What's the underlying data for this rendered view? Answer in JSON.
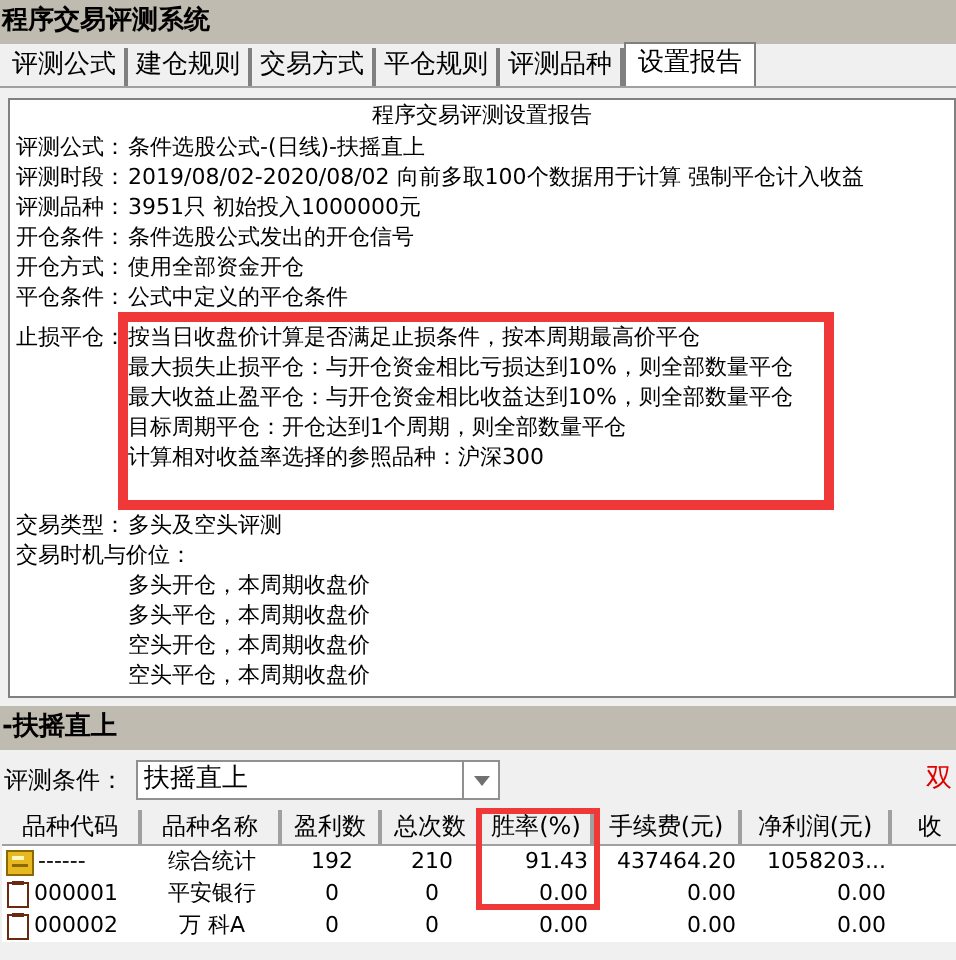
{
  "window": {
    "title": "程序交易评测系统"
  },
  "tabs": [
    {
      "label": "评测公式",
      "selected": false
    },
    {
      "label": "建仓规则",
      "selected": false
    },
    {
      "label": "交易方式",
      "selected": false
    },
    {
      "label": "平仓规则",
      "selected": false
    },
    {
      "label": "评测品种",
      "selected": false
    },
    {
      "label": "设置报告",
      "selected": true
    }
  ],
  "report": {
    "title": "程序交易评测设置报告",
    "blocks": [
      [
        {
          "kind": "inline",
          "label": "评测公式：",
          "lines": [
            "条件选股公式-(日线)-扶摇直上"
          ]
        },
        {
          "kind": "inline",
          "label": "评测时段：",
          "lines": [
            "2019/08/02-2020/08/02 向前多取100个数据用于计算 强制平仓计入收益"
          ]
        },
        {
          "kind": "inline",
          "label": "评测品种：",
          "lines": [
            "3951只 初始投入1000000元"
          ]
        },
        {
          "kind": "inline",
          "label": "开仓条件：",
          "lines": [
            "条件选股公式发出的开仓信号"
          ]
        },
        {
          "kind": "inline",
          "label": "开仓方式：",
          "lines": [
            "使用全部资金开仓"
          ]
        },
        {
          "kind": "inline",
          "label": "平仓条件：",
          "lines": [
            "公式中定义的平仓条件"
          ]
        },
        {
          "kind": "inline",
          "highlighted": true,
          "label": "止损平仓：",
          "lines": [
            "按当日收盘价计算是否满足止损条件，按本周期最高价平仓",
            "最大损失止损平仓：与开仓资金相比亏损达到10%，则全部数量平仓",
            "最大收益止盈平仓：与开仓资金相比收益达到10%，则全部数量平仓",
            "目标周期平仓：开仓达到1个周期，则全部数量平仓",
            "计算相对收益率选择的参照品种：沪深300"
          ]
        }
      ],
      [
        {
          "kind": "inline",
          "label": "交易类型：",
          "lines": [
            "多头及空头评测"
          ]
        },
        {
          "kind": "below",
          "label": "交易时机与价位：",
          "lines": [
            "多头开仓，本周期收盘价",
            "多头平仓，本周期收盘价",
            "空头开仓，本周期收盘价",
            "空头平仓，本周期收盘价"
          ]
        }
      ]
    ]
  },
  "panel": {
    "title": "-扶摇直上",
    "condition_label": "评测条件：",
    "condition_value": "扶摇直上",
    "hint": "双"
  },
  "table": {
    "columns": [
      "品种代码",
      "品种名称",
      "盈利数",
      "总次数",
      "胜率(%)",
      "手续费(元)",
      "净利润(元)",
      "收"
    ],
    "rows": [
      {
        "kind": "summary",
        "cells": [
          "------",
          "综合统计",
          "192",
          "210",
          "91.43",
          "437464.20",
          "1058203..."
        ]
      },
      {
        "kind": "stock",
        "cells": [
          "000001",
          "平安银行",
          "0",
          "0",
          "0.00",
          "0.00",
          "0.00"
        ]
      },
      {
        "kind": "stock",
        "cells": [
          "000002",
          "万 科A",
          "0",
          "0",
          "0.00",
          "0.00",
          "0.00"
        ]
      }
    ]
  }
}
